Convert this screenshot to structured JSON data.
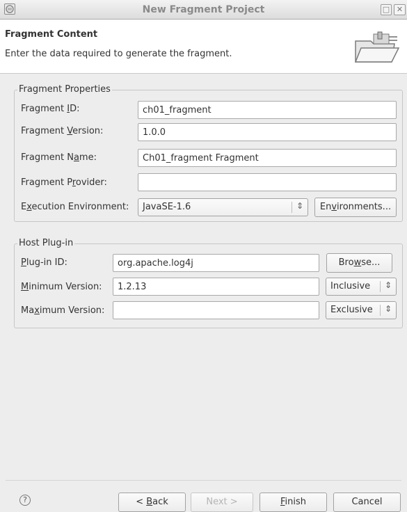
{
  "window": {
    "title": "New Fragment Project",
    "maximize_glyph": "□",
    "close_glyph": "✕"
  },
  "header": {
    "title": "Fragment Content",
    "description": "Enter the data required to generate the fragment."
  },
  "fragment_properties": {
    "legend": "Fragment Properties",
    "id": {
      "label_pre": "Fragment ",
      "label_key": "I",
      "label_post": "D:",
      "value": "ch01_fragment"
    },
    "version": {
      "label_pre": "Fragment ",
      "label_key": "V",
      "label_post": "ersion:",
      "value": "1.0.0"
    },
    "name": {
      "label_pre": "Fragment N",
      "label_key": "a",
      "label_post": "me:",
      "value": "Ch01_fragment Fragment"
    },
    "provider": {
      "label_pre": "Fragment P",
      "label_key": "r",
      "label_post": "ovider:",
      "value": ""
    },
    "execution_env": {
      "label_pre": "E",
      "label_key": "x",
      "label_post": "ecution Environment:",
      "value": "JavaSE-1.6",
      "button_pre": "En",
      "button_key": "v",
      "button_post": "ironments..."
    }
  },
  "host_plugin": {
    "legend": "Host Plug-in",
    "plugin_id": {
      "label_pre": "",
      "label_key": "P",
      "label_post": "lug-in ID:",
      "value": "org.apache.log4j",
      "button_pre": "Bro",
      "button_key": "w",
      "button_post": "se..."
    },
    "min_version": {
      "label_pre": "",
      "label_key": "M",
      "label_post": "inimum Version:",
      "value": "1.2.13",
      "mode": "Inclusive"
    },
    "max_version": {
      "label_pre": "Ma",
      "label_key": "x",
      "label_post": "imum Version:",
      "value": "",
      "mode": "Exclusive"
    }
  },
  "footer": {
    "help_glyph": "?",
    "back": {
      "pre": "< ",
      "key": "B",
      "post": "ack"
    },
    "next": "Next >",
    "finish": {
      "pre": "",
      "key": "F",
      "post": "inish"
    },
    "cancel": "Cancel"
  },
  "icons": {
    "app": "eclipse-icon",
    "maximize": "maximize-icon",
    "close": "close-icon",
    "wizard": "folder-wizard-icon",
    "combo_arrow": "updown-arrow-icon",
    "help": "help-icon"
  }
}
